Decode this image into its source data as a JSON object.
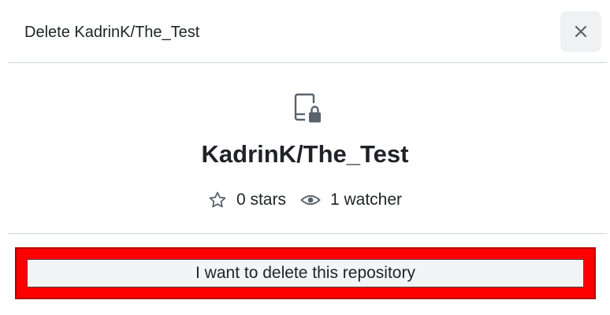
{
  "dialog": {
    "title": "Delete KadrinK/The_Test",
    "close_icon": "close-icon"
  },
  "repo": {
    "icon": "repo-locked-icon",
    "name": "KadrinK/The_Test",
    "stars_label": "0 stars",
    "stars_icon": "star-icon",
    "watchers_label": "1 watcher",
    "watchers_icon": "eye-icon"
  },
  "actions": {
    "confirm_label": "I want to delete this repository",
    "highlight_color": "#ff0000"
  }
}
